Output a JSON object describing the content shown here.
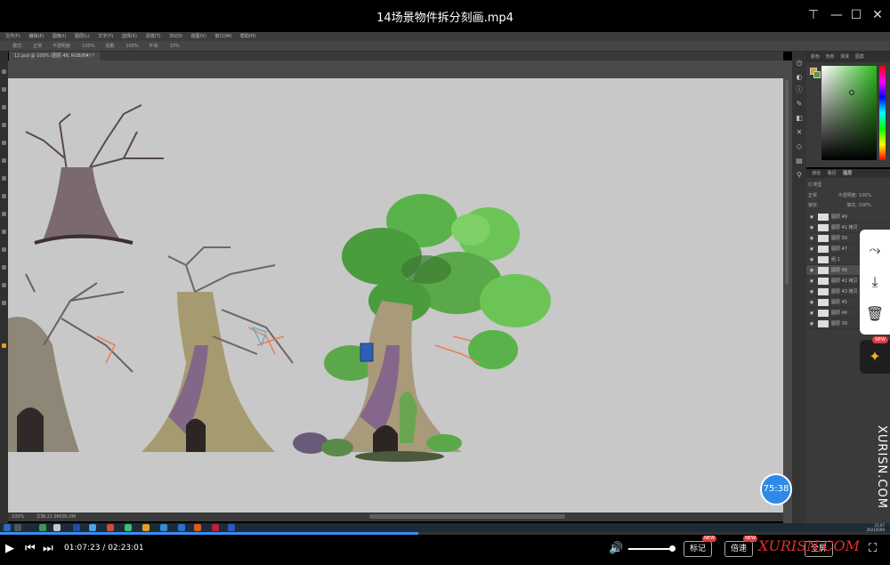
{
  "player": {
    "title": "14场景物件拆分刻画.mp4",
    "current_time": "01:07:23",
    "total_time": "02:23:01",
    "progress_fraction": 0.47,
    "volume_fraction": 0.9,
    "buttons": {
      "mark": "标记",
      "speed": "倍速",
      "fullscreen": "全屏"
    },
    "new_badge": "NEW",
    "timer_badge": "75:38",
    "watermark_vertical": "XURISN.COM",
    "watermark_bottom": "XURISN.COM"
  },
  "photoshop": {
    "menu": [
      "文件(F)",
      "编辑(E)",
      "图像(I)",
      "图层(L)",
      "文字(Y)",
      "选择(S)",
      "滤镜(T)",
      "3D(D)",
      "视图(V)",
      "窗口(W)",
      "帮助(H)"
    ],
    "options": [
      "模式:",
      "正常",
      "不透明度:",
      "100%",
      "流量:",
      "100%",
      "平滑:",
      "10%"
    ],
    "doc_tab": "12.psd @ 100% (图层 48, RGB/8#) *",
    "status": "100%",
    "status_doc": "文档:21.9M/95.0M"
  },
  "color_panel": {
    "tabs": [
      "颜色",
      "色板",
      "渐变",
      "图案"
    ],
    "fg_color": "#e0a21a",
    "bg_color": "#5b9b3b"
  },
  "layers_panel": {
    "tabs": [
      "通道",
      "路径",
      "图层"
    ],
    "filter_label": "Q 类型",
    "mode": "正常",
    "opacity_label": "不透明度: 100%",
    "lock_label": "锁定:",
    "fill_label": "填充: 100%",
    "layers": [
      "图层 49",
      "图层 41 拷贝",
      "图层 50",
      "图层 47",
      "组 1",
      "图层 48",
      "图层 42 拷贝",
      "图层 43 拷贝",
      "图层 45",
      "图层 46",
      "图层 39"
    ],
    "active_index": 5
  },
  "taskbar": {
    "time": "21:07",
    "date": "2021/6/09"
  }
}
